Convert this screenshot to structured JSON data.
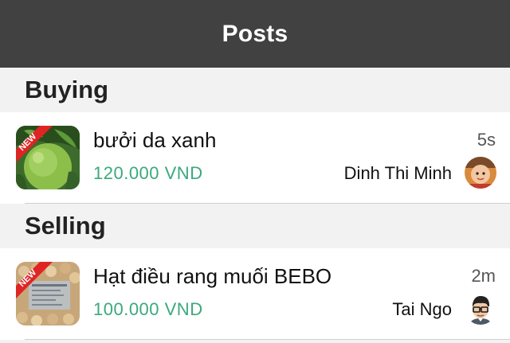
{
  "navbar": {
    "title": "Posts"
  },
  "sections": [
    {
      "title": "Buying",
      "items": [
        {
          "title": "bưởi da xanh",
          "price": "120.000 VND",
          "time": "5s",
          "seller": "Dinh Thi Minh",
          "badge": "NEW",
          "thumb_icon": "pomelo-photo",
          "avatar_icon": "child-photo-avatar"
        }
      ]
    },
    {
      "title": "Selling",
      "items": [
        {
          "title": "Hạt điều rang muối BEBO",
          "price": "100.000 VND",
          "time": "2m",
          "seller": "Tai Ngo",
          "badge": "NEW",
          "thumb_icon": "cashew-bag-photo",
          "avatar_icon": "cartoon-man-avatar"
        }
      ]
    }
  ],
  "colors": {
    "navbar_bg": "#414141",
    "price": "#3aa97c",
    "badge": "#e02424",
    "section_bg": "#f2f2f2"
  }
}
